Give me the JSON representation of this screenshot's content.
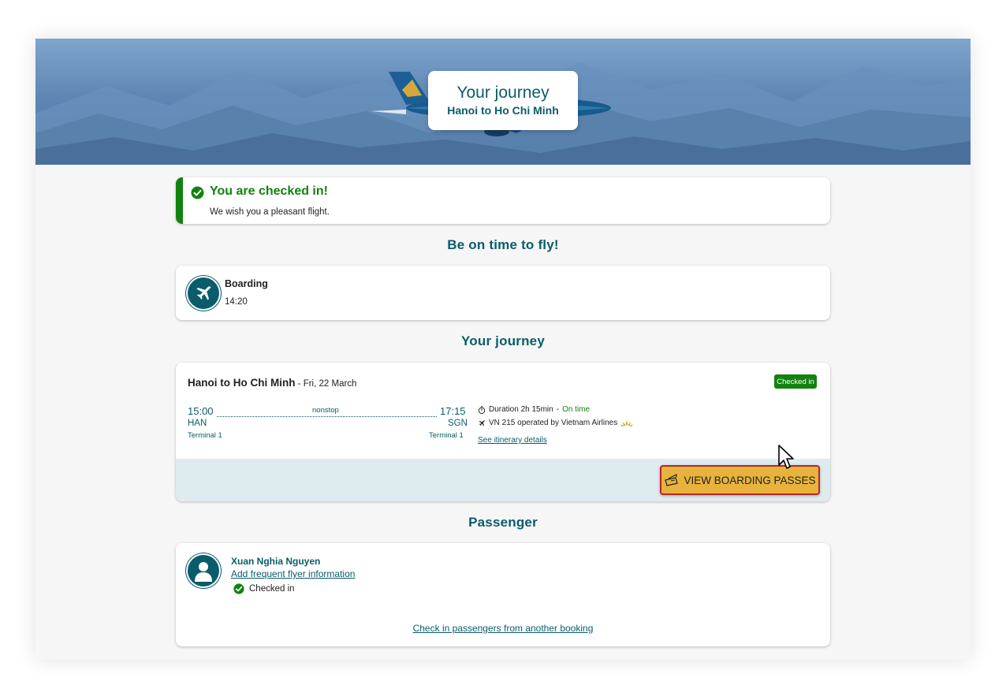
{
  "hero": {
    "title": "Your journey",
    "subtitle": "Hanoi to Ho Chi Minh"
  },
  "status": {
    "title": "You are checked in!",
    "message": "We wish you a pleasant flight.",
    "color": "#12820f"
  },
  "sections": {
    "on_time": "Be on time to fly!",
    "journey": "Your journey",
    "passenger": "Passenger"
  },
  "boarding": {
    "label": "Boarding",
    "time": "14:20",
    "icon": "airplane-icon"
  },
  "journey": {
    "route": "Hanoi to Ho Chi Minh",
    "date": " - Fri, 22 March",
    "badge": "Checked in",
    "departure": {
      "time": "15:00",
      "code": "HAN",
      "terminal": "Terminal 1"
    },
    "arrival": {
      "time": "17:15",
      "code": "SGN",
      "terminal": "Terminal 1"
    },
    "stops": "nonstop",
    "duration_label": "Duration 2h 15min",
    "duration_sep": " - ",
    "status": "On time",
    "flight": "VN 215  operated by Vietnam Airlines",
    "itinerary_link": "See itinerary details",
    "boarding_pass_button": "VIEW BOARDING PASSES"
  },
  "passenger": {
    "name": "Xuan Nghia Nguyen",
    "frequent_flyer_link": "Add frequent flyer information",
    "status": "Checked in",
    "other_booking_link": "Check in passengers from another booking"
  },
  "colors": {
    "primary": "#0a5c6b",
    "success": "#12820f",
    "button": "#e8b33c",
    "button_border": "#b8262a",
    "footer_bg": "#deebef"
  }
}
